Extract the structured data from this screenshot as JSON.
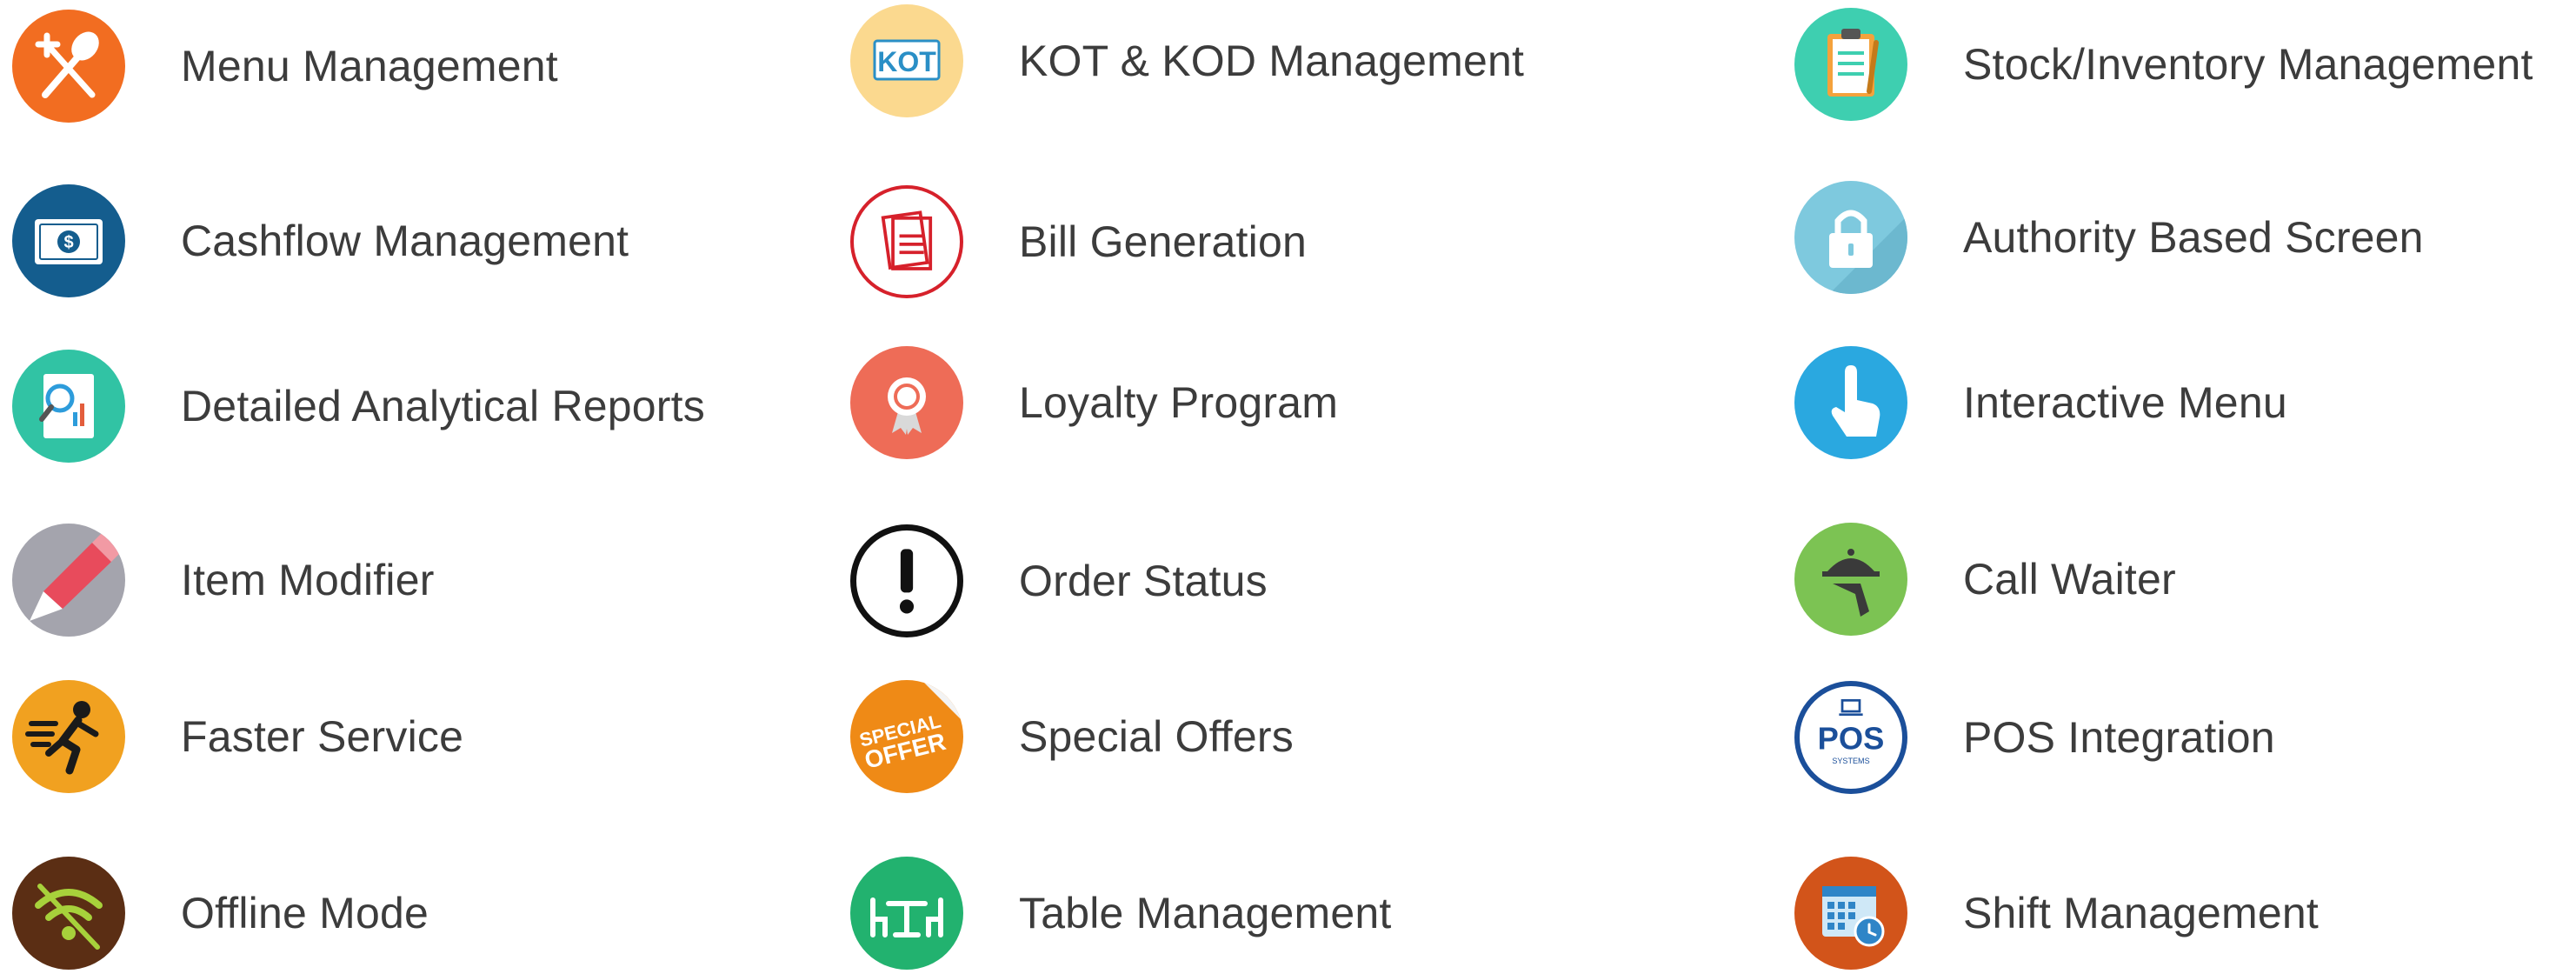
{
  "features": [
    {
      "label": "Menu Management",
      "icon": "fork-spoon-icon",
      "color": "#f26d21"
    },
    {
      "label": "KOT & KOD Management",
      "icon": "kot-icon",
      "color": "#fbd98f",
      "icon_text": "KOT"
    },
    {
      "label": "Stock/Inventory Management",
      "icon": "clipboard-icon",
      "color": "#3ecfb0"
    },
    {
      "label": "Cashflow Management",
      "icon": "cash-icon",
      "color": "#145d8e"
    },
    {
      "label": "Bill Generation",
      "icon": "bill-icon",
      "color": "#d6212b"
    },
    {
      "label": "Authority Based Screen",
      "icon": "lock-icon",
      "color": "#7ec9de"
    },
    {
      "label": "Detailed Analytical Reports",
      "icon": "report-icon",
      "color": "#31c3a4"
    },
    {
      "label": "Loyalty Program",
      "icon": "badge-icon",
      "color": "#ee6c57"
    },
    {
      "label": "Interactive Menu",
      "icon": "hand-pointer-icon",
      "color": "#2aa8e0"
    },
    {
      "label": "Item Modifier",
      "icon": "pencil-icon",
      "color": "#a4a4ad"
    },
    {
      "label": "Order Status",
      "icon": "exclamation-icon",
      "color": "#111111"
    },
    {
      "label": "Call Waiter",
      "icon": "waiter-icon",
      "color": "#7cc353"
    },
    {
      "label": "Faster Service",
      "icon": "running-man-icon",
      "color": "#f1a120"
    },
    {
      "label": "Special Offers",
      "icon": "special-offer-sticker-icon",
      "color": "#ef8a16",
      "icon_text": [
        "SPECIAL",
        "OFFER"
      ]
    },
    {
      "label": "POS Integration",
      "icon": "pos-systems-icon",
      "color": "#1b4f9a",
      "icon_text": [
        "POS",
        "SYSTEMS"
      ]
    },
    {
      "label": "Offline Mode",
      "icon": "wifi-off-icon",
      "color": "#5b2e14"
    },
    {
      "label": "Table Management",
      "icon": "table-icon",
      "color": "#22b26f"
    },
    {
      "label": "Shift Management",
      "icon": "calendar-clock-icon",
      "color": "#d2541a"
    }
  ]
}
